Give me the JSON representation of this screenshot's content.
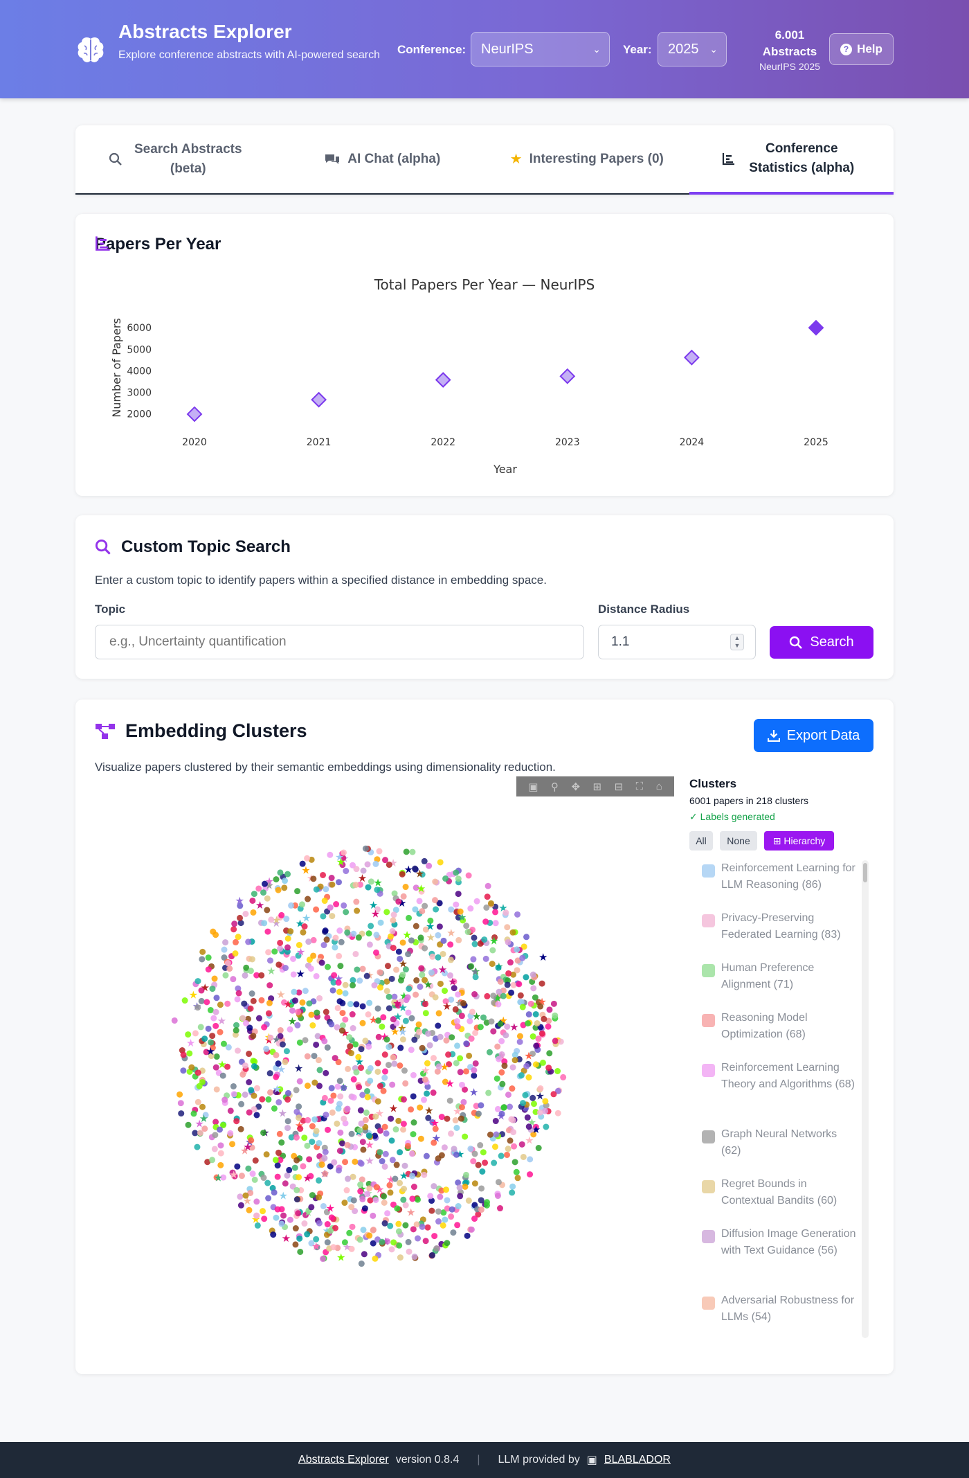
{
  "header": {
    "title": "Abstracts Explorer",
    "subtitle": "Explore conference abstracts with AI-powered search",
    "conference_label": "Conference:",
    "conference_value": "NeurIPS",
    "year_label": "Year:",
    "year_value": "2025",
    "abstract_count": "6.001",
    "abstract_label": "Abstracts",
    "abstract_sub": "NeurIPS 2025",
    "help_label": "Help"
  },
  "tabs": [
    {
      "label": "Search Abstracts (beta)",
      "icon": "search-icon"
    },
    {
      "label": "AI Chat (alpha)",
      "icon": "chat-icon"
    },
    {
      "label": "Interesting Papers (0)",
      "icon": "star-icon"
    },
    {
      "label": "Conference Statistics (alpha)",
      "icon": "bar-chart-icon",
      "active": true
    }
  ],
  "papers_per_year": {
    "section_title": "Papers Per Year"
  },
  "chart_data": {
    "type": "scatter",
    "title": "Total Papers Per Year — NeurIPS",
    "xlabel": "Year",
    "ylabel": "Number of Papers",
    "categories": [
      "2020",
      "2021",
      "2022",
      "2023",
      "2024",
      "2025"
    ],
    "values": [
      1990,
      2660,
      3580,
      3750,
      4620,
      6001
    ],
    "yticks": [
      2000,
      3000,
      4000,
      5000,
      6000
    ],
    "ylim": [
      1700,
      6200
    ],
    "marker": "diamond",
    "colors": {
      "fill": "#c4b0f5",
      "stroke": "#7c3aed",
      "highlight": "#7c3aed"
    },
    "grid": false
  },
  "topic_search": {
    "title": "Custom Topic Search",
    "description": "Enter a custom topic to identify papers within a specified distance in embedding space.",
    "topic_label": "Topic",
    "topic_placeholder": "e.g., Uncertainty quantification",
    "radius_label": "Distance Radius",
    "radius_value": "1.1",
    "search_label": "Search"
  },
  "clusters": {
    "title": "Embedding Clusters",
    "description": "Visualize papers clustered by their semantic embeddings using dimensionality reduction.",
    "export_label": "Export Data",
    "panel_title": "Clusters",
    "count_text": "6001 papers in 218 clusters",
    "status_text": "✓ Labels generated",
    "btn_all": "All",
    "btn_none": "None",
    "btn_hierarchy": "⊞ Hierarchy",
    "legend": [
      {
        "label": "Reinforcement Learning for LLM Reasoning (86)",
        "color": "#9ec9f2"
      },
      {
        "label": "Privacy-Preserving Federated Learning (83)",
        "color": "#f2b3d3"
      },
      {
        "label": "Human Preference Alignment (71)",
        "color": "#8fdc8f"
      },
      {
        "label": "Reasoning Model Optimization (68)",
        "color": "#f59a9a"
      },
      {
        "label": "Reinforcement Learning Theory and Algorithms (68)",
        "color": "#ef9cf2"
      },
      {
        "label": "Graph Neural Networks (62)",
        "color": "#9a9a9a"
      },
      {
        "label": "Regret Bounds in Contextual Bandits (60)",
        "color": "#e2c98a"
      },
      {
        "label": "Diffusion Image Generation with Text Guidance (56)",
        "color": "#c9a0d6"
      },
      {
        "label": "Adversarial Robustness for LLMs (54)",
        "color": "#f5b8a0"
      }
    ],
    "palette": [
      "#9ec9f2",
      "#f2b3d3",
      "#8fdc8f",
      "#f59a9a",
      "#ef9cf2",
      "#9a9a9a",
      "#e2c98a",
      "#c9a0d6",
      "#f5b8a0",
      "#1f1f7a",
      "#d9117a",
      "#2ca02c",
      "#e6194b",
      "#ff69b4",
      "#b8860b",
      "#4b0082",
      "#00a0a0",
      "#ffa500",
      "#7cfc00",
      "#c71585",
      "#87ceeb",
      "#dda0dd",
      "#8b4513",
      "#3cb371",
      "#ff1493",
      "#6a5acd",
      "#20b2aa",
      "#b22222",
      "#ffb6c1",
      "#9370db",
      "#000080",
      "#ff6347",
      "#32cd32",
      "#da70d6",
      "#708090",
      "#ffd700"
    ]
  },
  "footer": {
    "app_link": "Abstracts Explorer",
    "version": "version 0.8.4",
    "llm_text": "LLM provided by",
    "provider": "BLABLADOR"
  }
}
